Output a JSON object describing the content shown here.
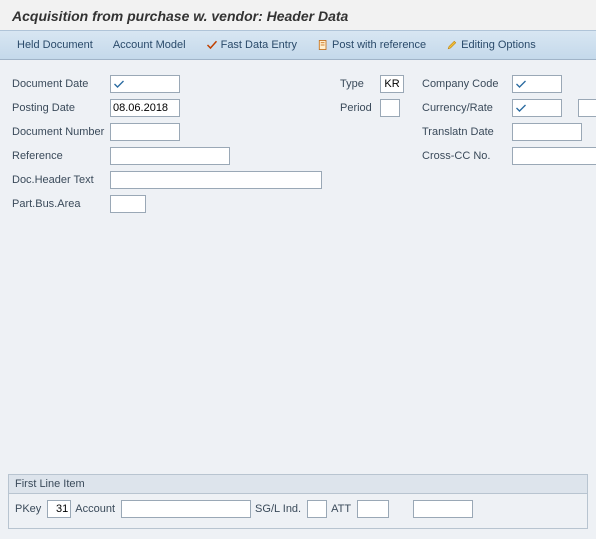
{
  "title": "Acquisition from purchase w. vendor: Header Data",
  "toolbar": {
    "held_doc": "Held Document",
    "acct_model": "Account Model",
    "fast_entry": "Fast Data Entry",
    "post_ref": "Post with reference",
    "edit_opts": "Editing Options"
  },
  "labels": {
    "doc_date": "Document Date",
    "posting_date": "Posting Date",
    "doc_number": "Document Number",
    "reference": "Reference",
    "header_text": "Doc.Header Text",
    "bus_area": "Part.Bus.Area",
    "type": "Type",
    "period": "Period",
    "company_code": "Company Code",
    "currency_rate": "Currency/Rate",
    "transl_date": "Translatn Date",
    "cross_cc": "Cross-CC No."
  },
  "fields": {
    "doc_date": "",
    "posting_date": "08.06.2018",
    "doc_number": "",
    "reference": "",
    "header_text": "",
    "bus_area": "",
    "type": "KR",
    "period": "",
    "company_code": "",
    "currency": "",
    "rate": "",
    "transl_date": "",
    "cross_cc": ""
  },
  "line_item": {
    "header": "First Line Item",
    "pkey_label": "PKey",
    "pkey": "31",
    "account_label": "Account",
    "account": "",
    "sgl_label": "SG/L Ind.",
    "sgl": "",
    "att_label": "ATT",
    "att": "",
    "extra": ""
  }
}
